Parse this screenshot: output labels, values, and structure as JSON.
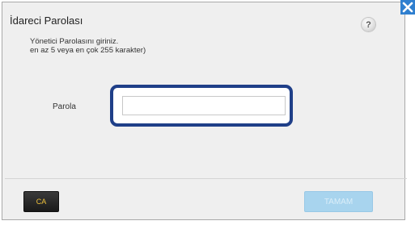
{
  "dialog": {
    "title": "İdareci Parolası",
    "instructions_line1": "Yönetici Parolasını giriniz.",
    "instructions_line2": "en az 5 veya en çok 255 karakter)",
    "help_label": "?",
    "close_icon": "close-icon",
    "help_icon": "help-icon"
  },
  "form": {
    "password_label": "Parola",
    "password_value": "",
    "password_placeholder": ""
  },
  "buttons": {
    "clear_label": "CA",
    "ok_label": "TAMAM",
    "ok_enabled": false
  },
  "colors": {
    "close_button": "#2f7fcf",
    "input_focus_border": "#1f3f88",
    "clear_button_bg": "#1a1a1a",
    "clear_button_text": "#f0c23a",
    "ok_button_disabled": "#a8d4ee"
  }
}
